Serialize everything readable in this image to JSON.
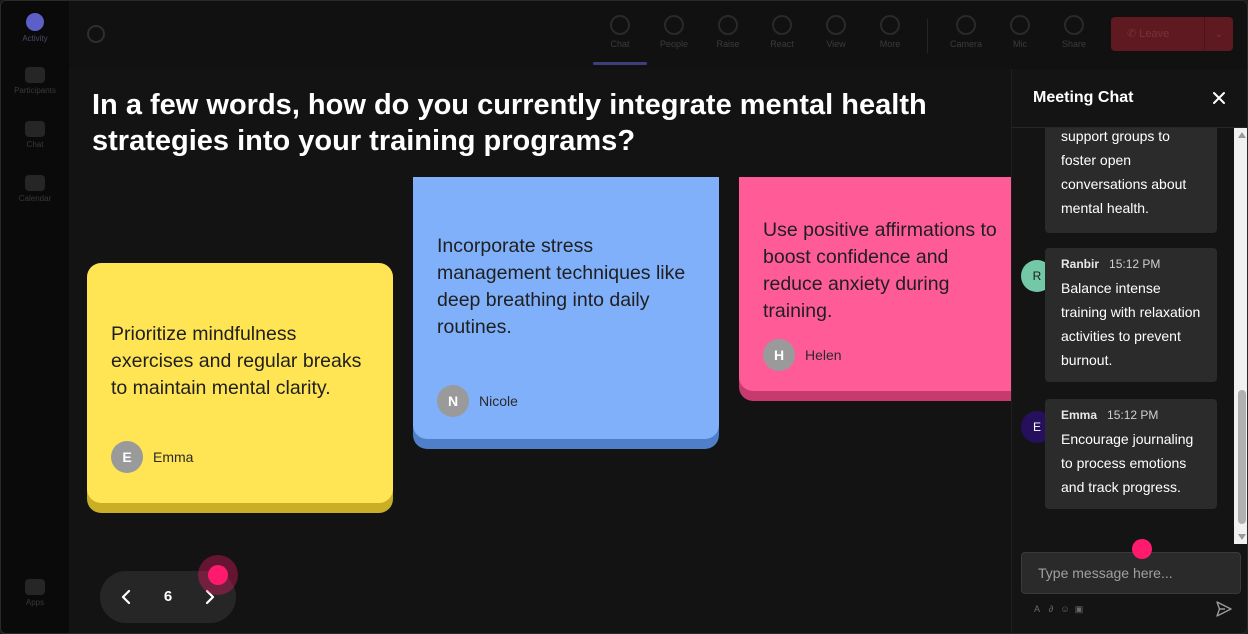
{
  "rail": {
    "items": [
      {
        "label": "Activity"
      },
      {
        "label": "Participants"
      },
      {
        "label": "Chat"
      },
      {
        "label": "Calendar"
      },
      {
        "label": "Apps"
      }
    ]
  },
  "toolbar": {
    "buttons": [
      {
        "label": "Chat"
      },
      {
        "label": "People"
      },
      {
        "label": "Raise"
      },
      {
        "label": "React"
      },
      {
        "label": "View"
      },
      {
        "label": "More"
      },
      {
        "label": "Camera"
      },
      {
        "label": "Mic"
      },
      {
        "label": "Share"
      }
    ],
    "leave_label": "Leave"
  },
  "question": "In a few words, how do you currently integrate mental health strategies into your training programs?",
  "cards": [
    {
      "text": "Prioritize mindfulness exercises and regular breaks to maintain mental clarity.",
      "initial": "E",
      "name": "Emma",
      "color": "#ffe453"
    },
    {
      "text": "Incorporate stress management techniques like deep breathing into daily routines.",
      "initial": "N",
      "name": "Nicole",
      "color": "#80b0fa"
    },
    {
      "text": "Use positive affirmations to boost confidence and reduce anxiety during training.",
      "initial": "H",
      "name": "Helen",
      "color": "#ff5c97"
    }
  ],
  "pager": {
    "page": "6",
    "prev": "‹",
    "next": "›"
  },
  "chat": {
    "title": "Meeting Chat",
    "close": "✕",
    "messages": [
      {
        "text": "support groups to foster open conversations about mental health."
      },
      {
        "author": "Ranbir",
        "time": "15:12 PM",
        "initial": "R",
        "text": "Balance intense training with relaxation activities to prevent burnout."
      },
      {
        "author": "Emma",
        "time": "15:12 PM",
        "initial": "E",
        "text": "Encourage journaling to process emotions and track progress."
      }
    ],
    "input_placeholder": "Type message here...",
    "format_icons": [
      "bold-icon",
      "link-icon",
      "emoji-icon",
      "image-icon"
    ]
  }
}
